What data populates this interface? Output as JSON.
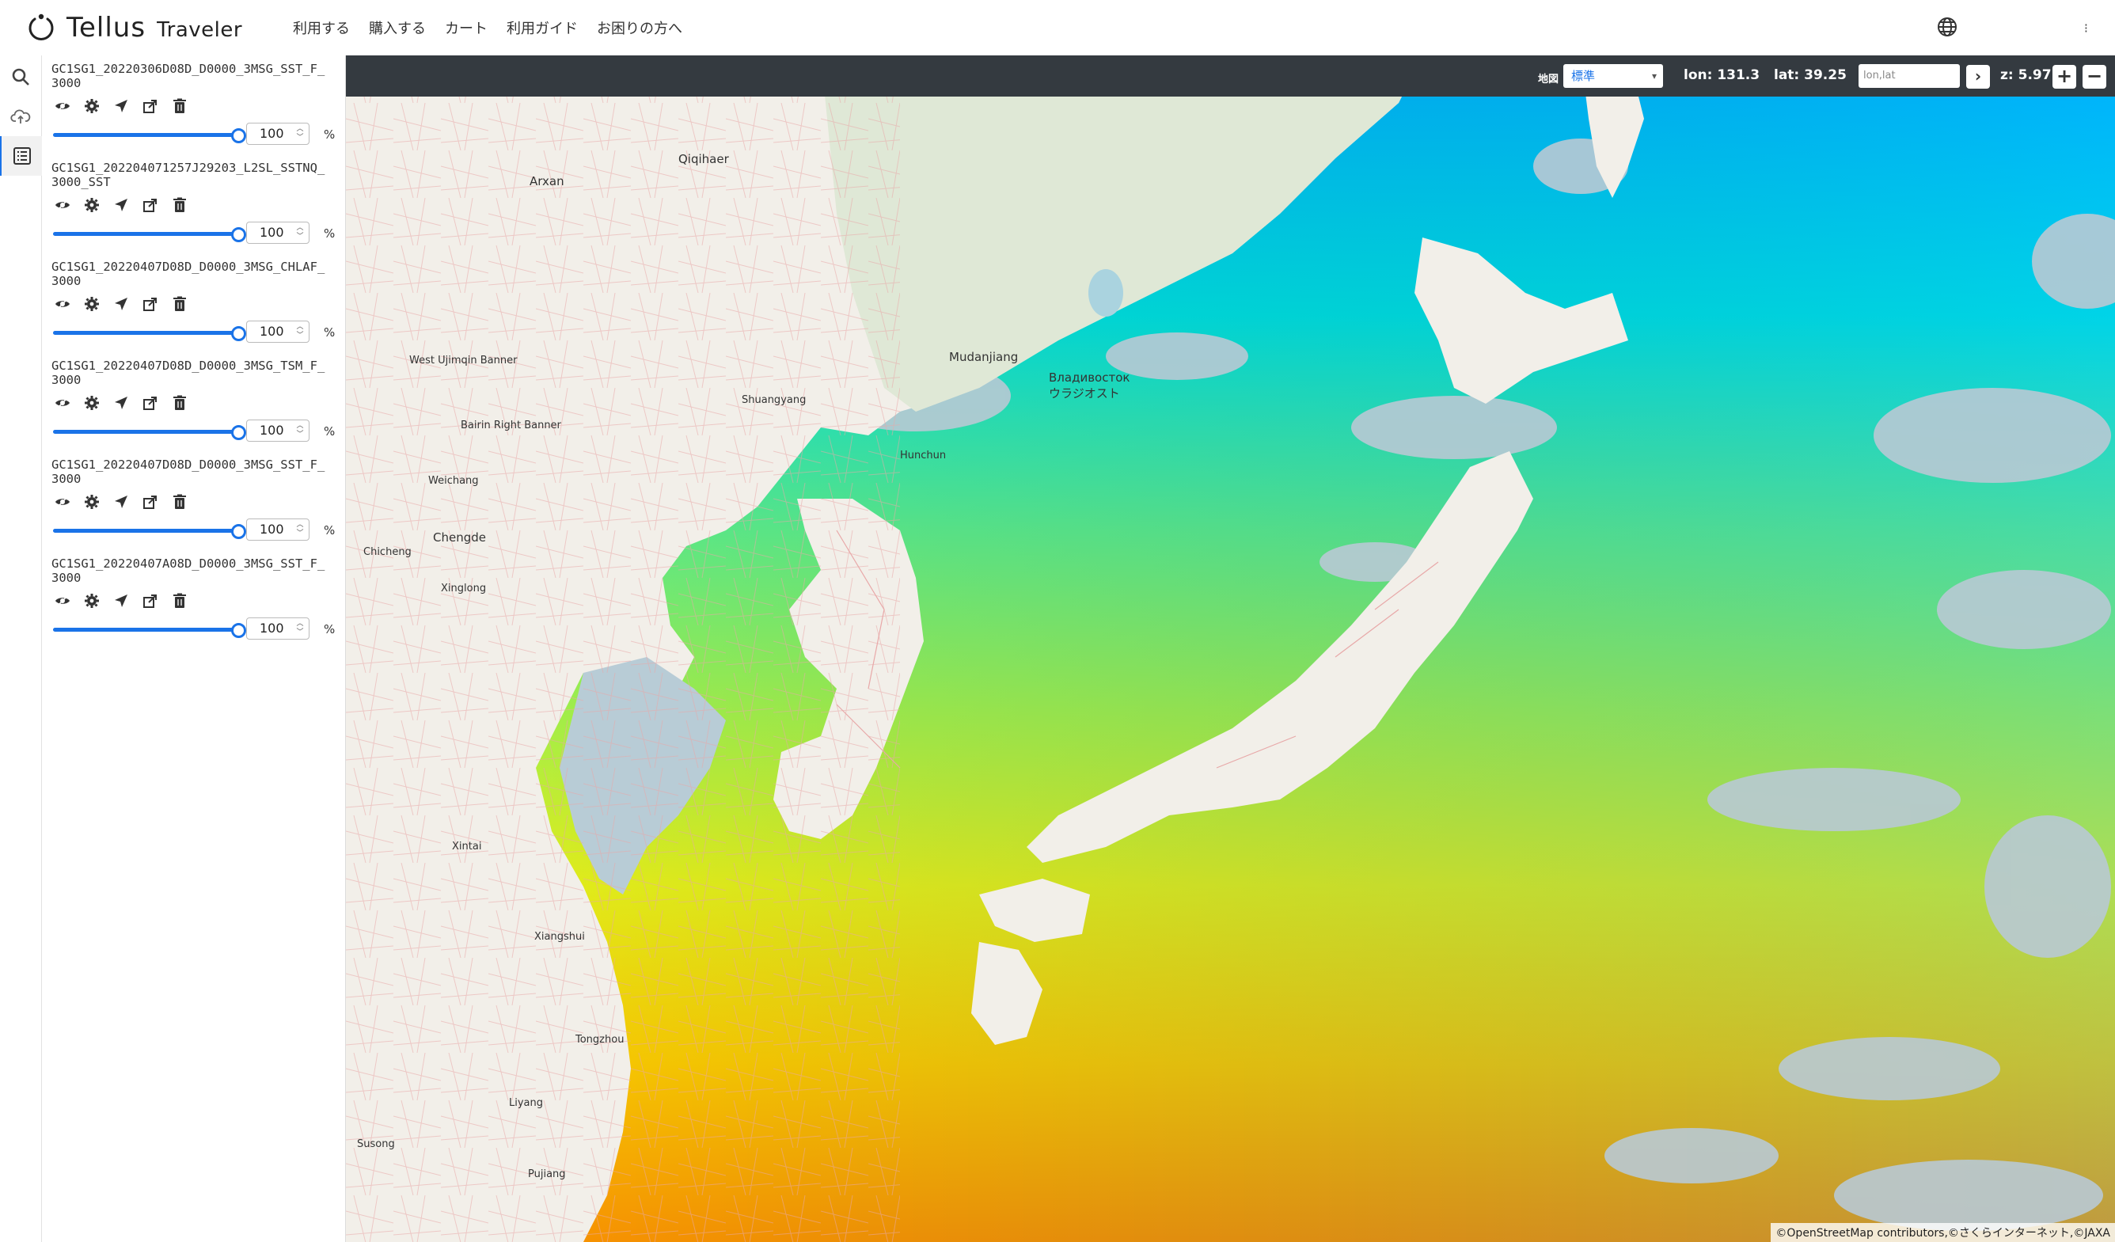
{
  "header": {
    "logo_text": "Tellus",
    "logo_sub": "Traveler",
    "nav": [
      "利用する",
      "購入する",
      "カート",
      "利用ガイド",
      "お困りの方へ"
    ],
    "more": "⁝"
  },
  "rail": {
    "icons": [
      "search-icon",
      "cloud-upload-icon",
      "layer-list-icon"
    ]
  },
  "layers": [
    {
      "name": "GC1SG1_20220306D08D_D0000_3MSG_SST_F_3000",
      "opacity": "100",
      "unit": "%"
    },
    {
      "name": "GC1SG1_202204071257J29203_L2SL_SSTNQ_3000_SST",
      "opacity": "100",
      "unit": "%"
    },
    {
      "name": "GC1SG1_20220407D08D_D0000_3MSG_CHLAF_3000",
      "opacity": "100",
      "unit": "%"
    },
    {
      "name": "GC1SG1_20220407D08D_D0000_3MSG_TSM_F_3000",
      "opacity": "100",
      "unit": "%"
    },
    {
      "name": "GC1SG1_20220407D08D_D0000_3MSG_SST_F_3000",
      "opacity": "100",
      "unit": "%"
    },
    {
      "name": "GC1SG1_20220407A08D_D0000_3MSG_SST_F_3000",
      "opacity": "100",
      "unit": "%"
    }
  ],
  "mapbar": {
    "map_label": "地図",
    "map_style": "標準",
    "lon": "lon: 131.3",
    "lat": "lat: 39.25",
    "coord_placeholder": "lon,lat",
    "go": "›",
    "zoom": "z: 5.97",
    "zoom_in": "+",
    "zoom_out": "−"
  },
  "places": [
    {
      "text": "Chengde"
    },
    {
      "text": "Mudanjiang"
    },
    {
      "text": "Владивосток"
    },
    {
      "text": "ウラジオスト"
    },
    {
      "text": "Qiqihaer"
    },
    {
      "text": "Arxan"
    },
    {
      "text": "West Ujimqin Banner"
    },
    {
      "text": "Bairin Right Banner"
    },
    {
      "text": "Shuangyang"
    },
    {
      "text": "Hunchun"
    },
    {
      "text": "Weichang"
    },
    {
      "text": "Chicheng"
    },
    {
      "text": "Xinglong"
    },
    {
      "text": "Xintai"
    },
    {
      "text": "Xiangshui"
    },
    {
      "text": "Tongzhou"
    },
    {
      "text": "Liyang"
    },
    {
      "text": "Susong"
    },
    {
      "text": "Pujiang"
    }
  ],
  "attribution": "©OpenStreetMap contributors,©さくらインターネット,©JAXA"
}
